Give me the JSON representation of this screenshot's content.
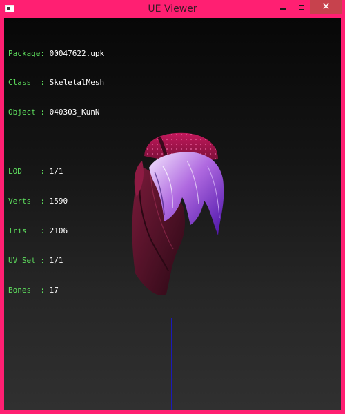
{
  "window": {
    "title": "UE Viewer",
    "controls": {
      "minimize": "minimize-icon",
      "maximize": "maximize-icon",
      "close": "close-icon",
      "close_glyph": "✕"
    }
  },
  "info": {
    "package_label": "Package:",
    "package_value": "00047622.upk",
    "class_label": "Class  :",
    "class_value": "SkeletalMesh",
    "object_label": "Object :",
    "object_value": "040303_KunN",
    "lod_label": "LOD    :",
    "lod_value": "1/1",
    "verts_label": "Verts  :",
    "verts_value": "1590",
    "tris_label": "Tris   :",
    "tris_value": "2106",
    "uvset_label": "UV Set :",
    "uvset_value": "1/1",
    "bones_label": "Bones  :",
    "bones_value": "17"
  },
  "colors": {
    "frame": "#ff1f72",
    "label_green": "#5ee05e",
    "value_white": "#ffffff",
    "axis_blue": "#1a1ab8",
    "close_red": "#c7424d"
  }
}
